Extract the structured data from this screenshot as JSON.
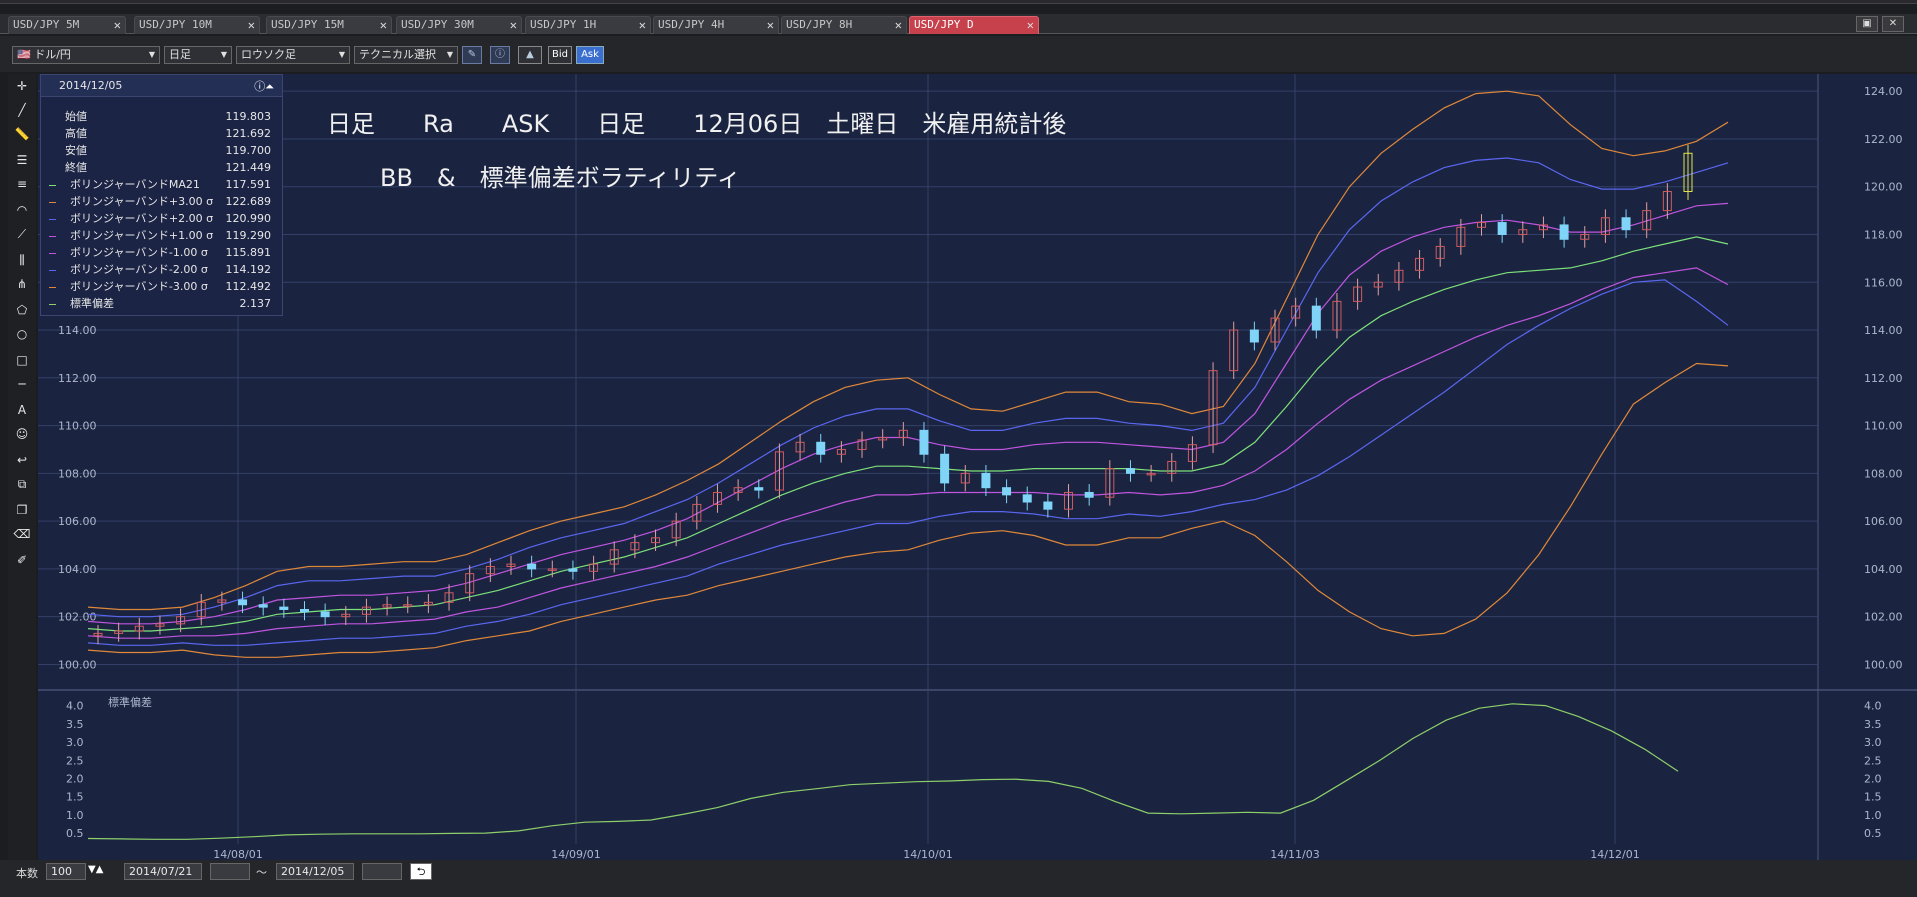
{
  "tabs": [
    {
      "label": "USD/JPY 5M",
      "active": false
    },
    {
      "label": "USD/JPY 10M",
      "active": false
    },
    {
      "label": "USD/JPY 15M",
      "active": false
    },
    {
      "label": "USD/JPY 30M",
      "active": false
    },
    {
      "label": "USD/JPY 1H",
      "active": false
    },
    {
      "label": "USD/JPY 4H",
      "active": false
    },
    {
      "label": "USD/JPY 8H",
      "active": false
    },
    {
      "label": "USD/JPY D",
      "active": true
    }
  ],
  "toolbar": {
    "pair": "ドル/円",
    "period": "日足",
    "chart_type": "ロウソク足",
    "technical": "テクニカル選択",
    "bid": "Bid",
    "ask": "Ask"
  },
  "info": {
    "date": "2014/12/05",
    "rows": [
      {
        "label": "始値",
        "value": "119.803"
      },
      {
        "label": "高値",
        "value": "121.692"
      },
      {
        "label": "安値",
        "value": "119.700"
      },
      {
        "label": "終値",
        "value": "121.449"
      },
      {
        "label": "ボリンジャーバンドMA21",
        "value": "117.591"
      },
      {
        "label": "ボリンジャーバンド+3.00 σ",
        "value": "122.689"
      },
      {
        "label": "ボリンジャーバンド+2.00 σ",
        "value": "120.990"
      },
      {
        "label": "ボリンジャーバンド+1.00 σ",
        "value": "119.290"
      },
      {
        "label": "ボリンジャーバンド-1.00 σ",
        "value": "115.891"
      },
      {
        "label": "ボリンジャーバンド-2.00 σ",
        "value": "114.192"
      },
      {
        "label": "ボリンジャーバンド-3.00 σ",
        "value": "112.492"
      },
      {
        "label": "標準偏差",
        "value": "2.137"
      }
    ]
  },
  "annotation": {
    "line1": "日足　　Ra　　ASK　　日足　　12月06日　土曜日　米雇用統計後",
    "line2": "BB　&　標準偏差ボラティリティ"
  },
  "chart_data": [
    {
      "type": "candlestick",
      "title": "",
      "y_ticks": [
        "124.00",
        "122.00",
        "120.00",
        "118.00",
        "116.00",
        "114.00",
        "112.00",
        "110.00",
        "108.00",
        "106.00",
        "104.00",
        "102.00",
        "100.00"
      ],
      "ylim": [
        99.6,
        124.3
      ],
      "x_labels": [
        "14/08/01",
        "14/09/01",
        "14/10/01",
        "14/11/03",
        "14/12/01"
      ],
      "x_range": [
        "2014/07/21",
        "2014/12/05"
      ],
      "bands": {
        "plus3": [
          102.4,
          102.3,
          102.3,
          102.4,
          102.8,
          103.3,
          103.9,
          104.1,
          104.1,
          104.2,
          104.3,
          104.3,
          104.6,
          105.1,
          105.6,
          106.0,
          106.3,
          106.6,
          107.1,
          107.7,
          108.4,
          109.3,
          110.2,
          111.0,
          111.6,
          111.9,
          112.0,
          111.3,
          110.7,
          110.6,
          111.0,
          111.4,
          111.4,
          111.0,
          110.9,
          110.5,
          110.8,
          112.6,
          115.3,
          118.0,
          120.0,
          121.4,
          122.4,
          123.3,
          123.9,
          124.0,
          123.8,
          122.6,
          121.6,
          121.3,
          121.5,
          121.9,
          122.7
        ],
        "plus2": [
          102.1,
          102.0,
          102.0,
          102.1,
          102.4,
          102.8,
          103.3,
          103.5,
          103.5,
          103.6,
          103.7,
          103.7,
          104.0,
          104.4,
          104.9,
          105.3,
          105.6,
          105.9,
          106.4,
          106.9,
          107.6,
          108.4,
          109.2,
          109.9,
          110.4,
          110.7,
          110.7,
          110.2,
          109.8,
          109.8,
          110.1,
          110.3,
          110.3,
          110.1,
          110.0,
          109.8,
          110.1,
          111.6,
          114.0,
          116.4,
          118.2,
          119.4,
          120.2,
          120.8,
          121.1,
          121.2,
          121.0,
          120.3,
          119.9,
          119.9,
          120.2,
          120.6,
          121.0
        ],
        "plus1": [
          101.8,
          101.7,
          101.7,
          101.8,
          102.0,
          102.3,
          102.7,
          102.8,
          102.9,
          102.9,
          103.0,
          103.1,
          103.4,
          103.8,
          104.2,
          104.6,
          104.9,
          105.2,
          105.6,
          106.1,
          106.8,
          107.5,
          108.2,
          108.8,
          109.2,
          109.5,
          109.5,
          109.2,
          109.0,
          109.0,
          109.2,
          109.3,
          109.3,
          109.2,
          109.1,
          109.0,
          109.3,
          110.5,
          112.6,
          114.7,
          116.3,
          117.3,
          117.9,
          118.3,
          118.5,
          118.6,
          118.4,
          118.1,
          118.1,
          118.4,
          118.8,
          119.2,
          119.3
        ],
        "ma": [
          101.5,
          101.4,
          101.4,
          101.5,
          101.6,
          101.8,
          102.1,
          102.2,
          102.3,
          102.3,
          102.4,
          102.5,
          102.8,
          103.1,
          103.5,
          103.9,
          104.2,
          104.5,
          104.9,
          105.3,
          105.9,
          106.5,
          107.1,
          107.6,
          108.0,
          108.3,
          108.3,
          108.2,
          108.1,
          108.1,
          108.2,
          108.2,
          108.2,
          108.2,
          108.1,
          108.1,
          108.4,
          109.3,
          110.8,
          112.4,
          113.7,
          114.6,
          115.2,
          115.7,
          116.1,
          116.4,
          116.5,
          116.6,
          116.9,
          117.3,
          117.6,
          117.9,
          117.6
        ],
        "minus1": [
          101.2,
          101.1,
          101.1,
          101.2,
          101.2,
          101.3,
          101.5,
          101.6,
          101.7,
          101.7,
          101.8,
          101.9,
          102.2,
          102.4,
          102.8,
          103.2,
          103.5,
          103.8,
          104.1,
          104.5,
          105.0,
          105.5,
          106.0,
          106.4,
          106.8,
          107.1,
          107.1,
          107.2,
          107.2,
          107.2,
          107.2,
          107.1,
          107.1,
          107.2,
          107.1,
          107.2,
          107.5,
          108.1,
          109.0,
          110.1,
          111.1,
          111.9,
          112.5,
          113.1,
          113.7,
          114.2,
          114.6,
          115.1,
          115.7,
          116.2,
          116.4,
          116.6,
          115.9
        ],
        "minus2": [
          100.9,
          100.8,
          100.8,
          100.9,
          100.8,
          100.8,
          100.9,
          101.0,
          101.1,
          101.1,
          101.2,
          101.3,
          101.6,
          101.8,
          102.1,
          102.5,
          102.8,
          103.1,
          103.4,
          103.7,
          104.2,
          104.6,
          105.0,
          105.3,
          105.6,
          105.9,
          105.9,
          106.2,
          106.4,
          106.4,
          106.3,
          106.1,
          106.1,
          106.3,
          106.2,
          106.4,
          106.7,
          106.9,
          107.3,
          107.9,
          108.7,
          109.6,
          110.5,
          111.4,
          112.4,
          113.4,
          114.2,
          114.9,
          115.5,
          116.0,
          116.1,
          115.2,
          114.2
        ],
        "minus3": [
          100.6,
          100.5,
          100.5,
          100.6,
          100.4,
          100.3,
          100.3,
          100.4,
          100.5,
          100.5,
          100.6,
          100.7,
          101.0,
          101.2,
          101.4,
          101.8,
          102.1,
          102.4,
          102.7,
          102.9,
          103.3,
          103.6,
          103.9,
          104.2,
          104.5,
          104.7,
          104.8,
          105.2,
          105.5,
          105.6,
          105.4,
          105.0,
          105.0,
          105.3,
          105.3,
          105.7,
          106.0,
          105.4,
          104.3,
          103.1,
          102.2,
          101.5,
          101.2,
          101.3,
          101.9,
          103.0,
          104.6,
          106.6,
          108.8,
          110.9,
          111.8,
          112.6,
          112.5
        ]
      },
      "candles_close": [
        101.3,
        101.4,
        101.6,
        101.7,
        102.0,
        102.6,
        102.7,
        102.5,
        102.4,
        102.3,
        102.2,
        102.0,
        102.1,
        102.4,
        102.5,
        102.5,
        102.6,
        103.0,
        103.8,
        104.1,
        104.2,
        104.0,
        104.0,
        103.9,
        104.2,
        104.8,
        105.1,
        105.3,
        106.0,
        106.7,
        107.2,
        107.4,
        107.3,
        108.9,
        109.3,
        108.8,
        109.0,
        109.4,
        109.5,
        109.8,
        108.8,
        107.6,
        108.0,
        107.4,
        107.1,
        106.8,
        106.5,
        107.2,
        107.0,
        108.2,
        108.0,
        108.0,
        108.5,
        109.2,
        112.3,
        114.0,
        113.5,
        114.5,
        115.0,
        114.0,
        115.2,
        115.8,
        116.0,
        116.5,
        117.0,
        117.5,
        118.3,
        118.5,
        118.0,
        118.2,
        118.4,
        117.8,
        118.0,
        118.7,
        118.2,
        119.0,
        119.8,
        121.4
      ],
      "last_candle": {
        "open": "119.803",
        "high": "121.692",
        "low": "119.700",
        "close": "121.449"
      }
    },
    {
      "type": "line",
      "title": "標準偏差",
      "y_ticks": [
        "4.0",
        "3.5",
        "3.0",
        "2.5",
        "2.0",
        "1.5",
        "1.0",
        "0.5"
      ],
      "ylim": [
        0.2,
        4.1
      ],
      "values": [
        0.35,
        0.34,
        0.33,
        0.33,
        0.36,
        0.4,
        0.45,
        0.47,
        0.48,
        0.48,
        0.48,
        0.49,
        0.5,
        0.56,
        0.7,
        0.8,
        0.82,
        0.86,
        1.02,
        1.2,
        1.45,
        1.62,
        1.72,
        1.83,
        1.87,
        1.91,
        1.93,
        1.97,
        1.98,
        1.92,
        1.73,
        1.37,
        1.05,
        1.03,
        1.05,
        1.07,
        1.05,
        1.4,
        1.95,
        2.5,
        3.1,
        3.6,
        3.93,
        4.05,
        4.0,
        3.7,
        3.3,
        2.8,
        2.2
      ]
    }
  ],
  "bottom": {
    "count_label": "本数",
    "count_value": "100",
    "from": "2014/07/21",
    "to": "2014/12/05",
    "tilde": "～"
  },
  "colors": {
    "bg": "#1a2440",
    "grid": "#3a4670",
    "up": "#d05a60",
    "down": "#7fd4f8",
    "plus3": "#e0883a",
    "plus2": "#5a66f0",
    "plus1": "#c055e0",
    "ma": "#7ee07a",
    "minus1": "#c055e0",
    "minus2": "#5a66f0",
    "minus3": "#e0883a",
    "stddev": "#8ecf6a",
    "last": "#e3e34a"
  }
}
